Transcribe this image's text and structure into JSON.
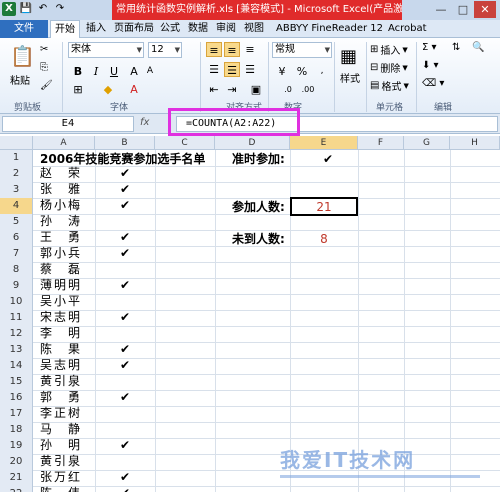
{
  "titlebar": {
    "title": "常用统计函数实例解析.xls [兼容模式] - Microsoft Excel(产品激活失败)",
    "logo": "X",
    "min": "—",
    "max": "□",
    "close": "✕"
  },
  "tabs": [
    "文件",
    "开始",
    "插入",
    "页面布局",
    "公式",
    "数据",
    "审阅",
    "视图",
    "ABBYY FineReader 12",
    "Acrobat"
  ],
  "ribbon": {
    "paste": "粘贴",
    "font_name": "宋体",
    "font_size": "12",
    "number_format": "常规",
    "style": "样式",
    "insert": "插入",
    "delete": "删除",
    "format": "格式",
    "groups": {
      "clipboard": "剪贴板",
      "font": "字体",
      "alignment": "对齐方式",
      "number": "数字",
      "cells": "单元格",
      "editing": "编辑"
    },
    "icons": [
      "cut-icon",
      "copy-icon",
      "format-painter-icon",
      "bold-icon",
      "italic-icon",
      "underline-icon",
      "align-icon",
      "sum-icon",
      "sort-icon",
      "find-icon"
    ]
  },
  "formula_bar": {
    "name_box": "E4",
    "fx": "fx",
    "formula": "=COUNTA(A2:A22)"
  },
  "columns": [
    "A",
    "B",
    "C",
    "D",
    "E",
    "F",
    "G",
    "H"
  ],
  "rows": [
    "1",
    "2",
    "3",
    "4",
    "5",
    "6",
    "7",
    "8",
    "9",
    "10",
    "11",
    "12",
    "13",
    "14",
    "15",
    "16",
    "17",
    "18",
    "19",
    "20",
    "21",
    "22"
  ],
  "sheet": {
    "header": "2006年技能竞赛参加选手名单",
    "names": [
      "赵　荣",
      "张　雅",
      "杨小梅",
      "孙　涛",
      "王　勇",
      "郭小兵",
      "蔡　磊",
      "薄明明",
      "吴小平",
      "宋志明",
      "李　明",
      "陈　果",
      "吴志明",
      "黄引泉",
      "郭　勇",
      "李正树",
      "马　静",
      "孙　明",
      "黄引泉",
      "张万红",
      "陈　伟"
    ],
    "checks": [
      "✔",
      "✔",
      "✔",
      "",
      "✔",
      "✔",
      "",
      "✔",
      "",
      "✔",
      "",
      "✔",
      "✔",
      "",
      "✔",
      "",
      "",
      "✔",
      "",
      "✔",
      "✔"
    ],
    "label_on_time": "准时参加:",
    "on_time_mark": "✔",
    "label_joined": "参加人数:",
    "joined_value": "21",
    "label_absent": "未到人数:",
    "absent_value": "8"
  },
  "watermark": "我爱IT技术网"
}
